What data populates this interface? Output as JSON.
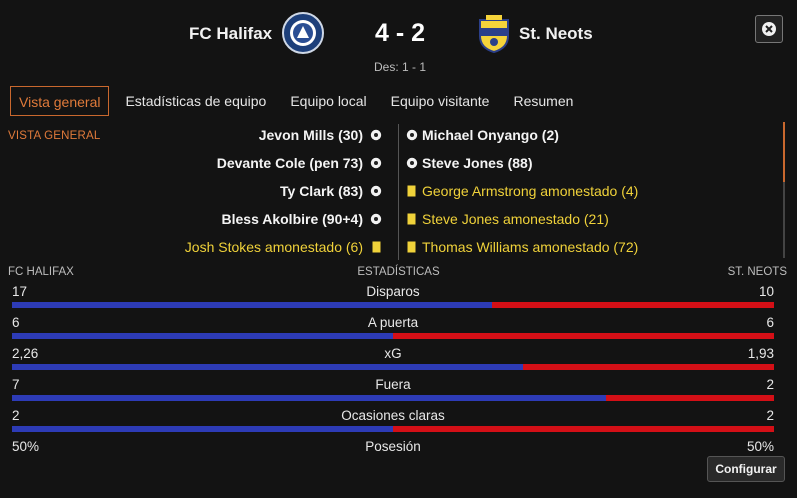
{
  "match": {
    "home_team": "FC Halifax",
    "away_team": "St. Neots",
    "score": "4 - 2",
    "halftime": "Des: 1 - 1"
  },
  "tabs": [
    {
      "label": "Vista general",
      "active": true
    },
    {
      "label": "Estadísticas de equipo",
      "active": false
    },
    {
      "label": "Equipo local",
      "active": false
    },
    {
      "label": "Equipo visitante",
      "active": false
    },
    {
      "label": "Resumen",
      "active": false
    }
  ],
  "section_label": "VISTA GENERAL",
  "events": {
    "home": [
      {
        "text": "Jevon Mills (30)",
        "type": "goal"
      },
      {
        "text": "Devante Cole (pen 73)",
        "type": "goal"
      },
      {
        "text": "Ty Clark (83)",
        "type": "goal"
      },
      {
        "text": "Bless Akolbire (90+4)",
        "type": "goal"
      },
      {
        "text": "Josh Stokes amonestado (6)",
        "type": "card"
      }
    ],
    "away": [
      {
        "text": "Michael Onyango (2)",
        "type": "goal"
      },
      {
        "text": "Steve Jones (88)",
        "type": "goal"
      },
      {
        "text": "George Armstrong amonestado (4)",
        "type": "card"
      },
      {
        "text": "Steve Jones amonestado (21)",
        "type": "card"
      },
      {
        "text": "Thomas Williams amonestado (72)",
        "type": "card"
      }
    ]
  },
  "stats": {
    "home_label": "FC HALIFAX",
    "title": "ESTADÍSTICAS",
    "away_label": "ST. NEOTS",
    "rows": [
      {
        "label": "Disparos",
        "home": "17",
        "away": "10",
        "home_share": 0.63
      },
      {
        "label": "A puerta",
        "home": "6",
        "away": "6",
        "home_share": 0.5
      },
      {
        "label": "xG",
        "home": "2,26",
        "away": "1,93",
        "home_share": 0.67
      },
      {
        "label": "Fuera",
        "home": "7",
        "away": "2",
        "home_share": 0.78
      },
      {
        "label": "Ocasiones claras",
        "home": "2",
        "away": "2",
        "home_share": 0.5
      },
      {
        "label": "Posesión",
        "home": "50%",
        "away": "50%"
      }
    ]
  },
  "buttons": {
    "configure": "Configurar"
  },
  "colors": {
    "accent": "#e07a3a",
    "home_bar": "#2d3bb6",
    "away_bar": "#d40f16",
    "card": "#f0d23a"
  }
}
